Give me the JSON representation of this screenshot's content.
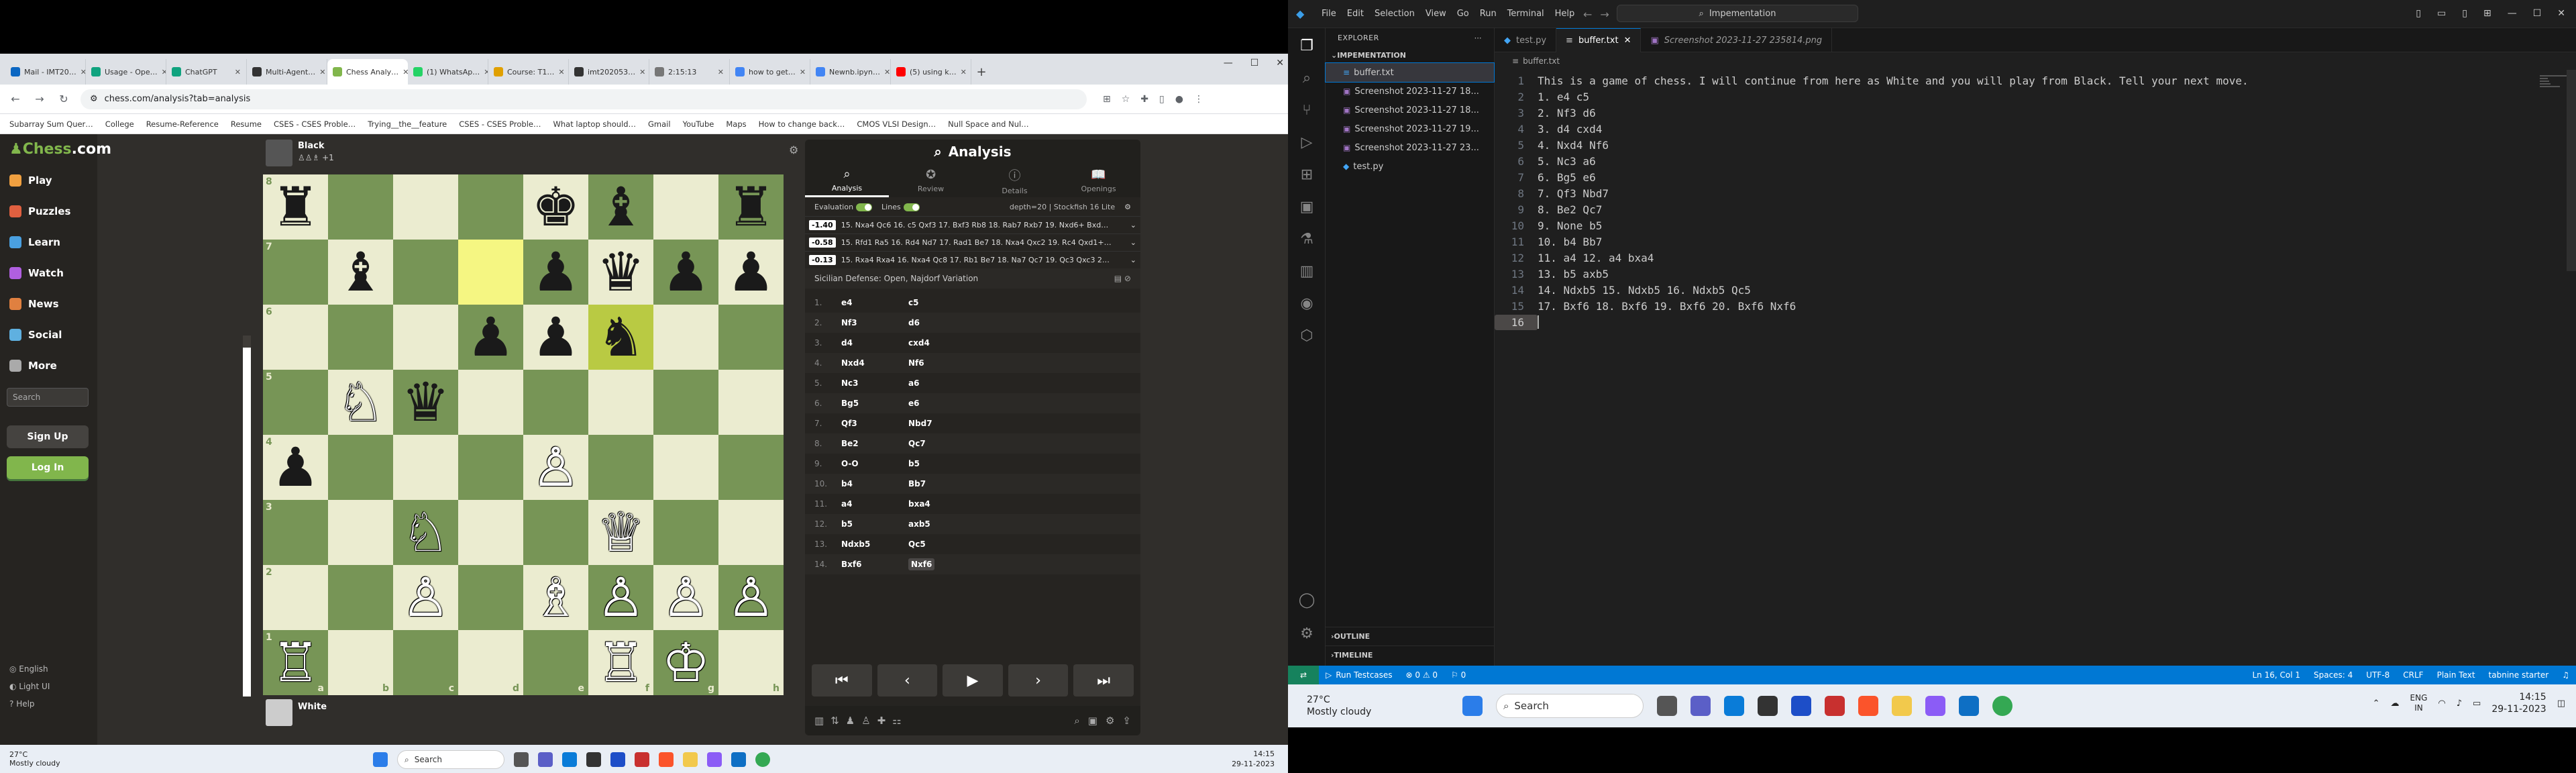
{
  "browser": {
    "tabs": [
      {
        "label": "Mail - IMT20…",
        "color": "#0a66c2",
        "active": false
      },
      {
        "label": "Usage - Ope…",
        "color": "#10a37f",
        "active": false
      },
      {
        "label": "ChatGPT",
        "color": "#10a37f",
        "active": false
      },
      {
        "label": "Multi-Agent…",
        "color": "#333333",
        "active": false
      },
      {
        "label": "Chess Analy…",
        "color": "#81b64c",
        "active": true
      },
      {
        "label": "(1) WhatsAp…",
        "color": "#25d366",
        "active": false
      },
      {
        "label": "Course: T1…",
        "color": "#e0a000",
        "active": false
      },
      {
        "label": "imt202053…",
        "color": "#333333",
        "active": false
      },
      {
        "label": "2:15:13",
        "color": "#777777",
        "active": false
      },
      {
        "label": "how to get…",
        "color": "#4285f4",
        "active": false
      },
      {
        "label": "Newnb.ipyn…",
        "color": "#4285f4",
        "active": false
      },
      {
        "label": "(5) using k…",
        "color": "#ff0000",
        "active": false
      }
    ],
    "url": "chess.com/analysis?tab=analysis",
    "bookmarks": [
      "Subarray Sum Quer…",
      "College",
      "Resume-Reference",
      "Resume",
      "CSES - CSES Proble…",
      "Trying__the__feature",
      "CSES - CSES Proble…",
      "What laptop should…",
      "Gmail",
      "YouTube",
      "Maps",
      "How to change back…",
      "CMOS VLSI Design…",
      "Null Space and Nul…"
    ]
  },
  "chess": {
    "logo_a": "Chess",
    "logo_b": ".com",
    "nav": [
      {
        "label": "Play",
        "color": "#f0a040"
      },
      {
        "label": "Puzzles",
        "color": "#e06040"
      },
      {
        "label": "Learn",
        "color": "#4aa0e0"
      },
      {
        "label": "Watch",
        "color": "#b05fe0"
      },
      {
        "label": "News",
        "color": "#e08040"
      },
      {
        "label": "Social",
        "color": "#5fb0e0"
      },
      {
        "label": "More",
        "color": "#aaaaaa"
      }
    ],
    "search_placeholder": "Search",
    "signup": "Sign Up",
    "login": "Log In",
    "footer": [
      "English",
      "Light UI",
      "Help"
    ],
    "black_name": "Black",
    "black_sub": "+1",
    "white_name": "White",
    "board": [
      [
        "♜",
        "",
        "",
        "",
        "♚",
        "♝",
        "",
        "♜"
      ],
      [
        "",
        "♝",
        "",
        "",
        "♟",
        "♛",
        "♟",
        "♟"
      ],
      [
        "",
        "",
        "",
        "♟",
        "♟",
        "♞",
        "",
        ""
      ],
      [
        "",
        "♘",
        "♛",
        "",
        "",
        "",
        "",
        ""
      ],
      [
        "♟",
        "",
        "",
        "",
        "♙",
        "",
        "",
        ""
      ],
      [
        "",
        "",
        "♘",
        "",
        "",
        "♕",
        "",
        ""
      ],
      [
        "",
        "",
        "♙",
        "",
        "♗",
        "♙",
        "♙",
        "♙"
      ],
      [
        "♖",
        "",
        "",
        "",
        "",
        "♖",
        "♔",
        ""
      ]
    ],
    "board_pieces": "rwbk",
    "highlight_squares": [
      "d7",
      "f6"
    ],
    "ranks": [
      "8",
      "7",
      "6",
      "5",
      "4",
      "3",
      "2",
      "1"
    ],
    "files": [
      "a",
      "b",
      "c",
      "d",
      "e",
      "f",
      "g",
      "h"
    ]
  },
  "analysis": {
    "title": "Analysis",
    "tabs": [
      {
        "label": "Analysis",
        "icon": "⌕"
      },
      {
        "label": "Review",
        "icon": "✪"
      },
      {
        "label": "Details",
        "icon": "ⓘ"
      },
      {
        "label": "Openings",
        "icon": "📖"
      }
    ],
    "evaluation_label": "Evaluation",
    "lines_label": "Lines",
    "depth": "depth=20 | Stockfish 16 Lite",
    "lines": [
      {
        "score": "-1.40",
        "text": "15. Nxa4 Qc6 16. c5 Qxf3 17. Bxf3 Rb8 18. Rab7 Rxb7 19. Nxd6+ Bxd…"
      },
      {
        "score": "-0.58",
        "text": "15. Rfd1 Ra5 16. Rd4 Nd7 17. Rad1 Be7 18. Nxa4 Qxc2 19. Rc4 Qxd1+…"
      },
      {
        "score": "-0.13",
        "text": "15. Rxa4 Rxa4 16. Nxa4 Qc8 17. Rb1 Be7 18. Na7 Qc7 19. Qc3 Qxc3 2…"
      }
    ],
    "opening": "Sicilian Defense: Open, Najdorf Variation",
    "moves": [
      [
        "1.",
        "e4",
        "c5"
      ],
      [
        "2.",
        "Nf3",
        "d6"
      ],
      [
        "3.",
        "d4",
        "cxd4"
      ],
      [
        "4.",
        "Nxd4",
        "Nf6"
      ],
      [
        "5.",
        "Nc3",
        "a6"
      ],
      [
        "6.",
        "Bg5",
        "e6"
      ],
      [
        "7.",
        "Qf3",
        "Nbd7"
      ],
      [
        "8.",
        "Be2",
        "Qc7"
      ],
      [
        "9.",
        "O-O",
        "b5"
      ],
      [
        "10.",
        "b4",
        "Bb7"
      ],
      [
        "11.",
        "a4",
        "bxa4"
      ],
      [
        "12.",
        "b5",
        "axb5"
      ],
      [
        "13.",
        "Ndxb5",
        "Qc5"
      ],
      [
        "14.",
        "Bxf6",
        "Nxf6"
      ]
    ]
  },
  "taskbar_left": {
    "temp": "27°C",
    "cond": "Mostly cloudy",
    "search": "Search",
    "time": "14:15",
    "date": "29-11-2023"
  },
  "vscode": {
    "menu": [
      "File",
      "Edit",
      "Selection",
      "View",
      "Go",
      "Run",
      "Terminal",
      "Help"
    ],
    "search": "Impementation",
    "explorer": "EXPLORER",
    "folder": "IMPEMENTATION",
    "files": [
      "buffer.txt",
      "Screenshot 2023-11-27 18...",
      "Screenshot 2023-11-27 18...",
      "Screenshot 2023-11-27 19...",
      "Screenshot 2023-11-27 23...",
      "test.py"
    ],
    "outline": "OUTLINE",
    "timeline": "TIMELINE",
    "tabs": [
      "test.py",
      "buffer.txt",
      "Screenshot 2023-11-27 235814.png"
    ],
    "breadcrumb": "buffer.txt",
    "lines": [
      "This is a game of chess. I will continue from here as White and you will play from Black. Tell your next move.",
      "1. e4 c5",
      "2. Nf3 d6",
      "3. d4 cxd4",
      "4. Nxd4 Nf6",
      "5. Nc3 a6",
      "6. Bg5 e6",
      "7. Qf3 Nbd7",
      "8. Be2 Qc7",
      "9. None b5",
      "10. b4 Bb7",
      "11. a4 12. a4 bxa4",
      "13. b5 axb5",
      "14. Ndxb5 15. Ndxb5 16. Ndxb5 Qc5",
      "17. Bxf6 18. Bxf6 19. Bxf6 20. Bxf6 Nxf6",
      ""
    ],
    "status_left": [
      "Run Testcases",
      "⊗ 0 ⚠ 0",
      "⚐ 0"
    ],
    "status_right": [
      "Ln 16, Col 1",
      "Spaces: 4",
      "UTF-8",
      "CRLF",
      "Plain Text",
      "tabnine starter"
    ]
  },
  "taskbar_right": {
    "temp": "27°C",
    "cond": "Mostly cloudy",
    "search": "Search",
    "lang1": "ENG",
    "lang2": "IN",
    "time": "14:15",
    "date": "29-11-2023"
  }
}
